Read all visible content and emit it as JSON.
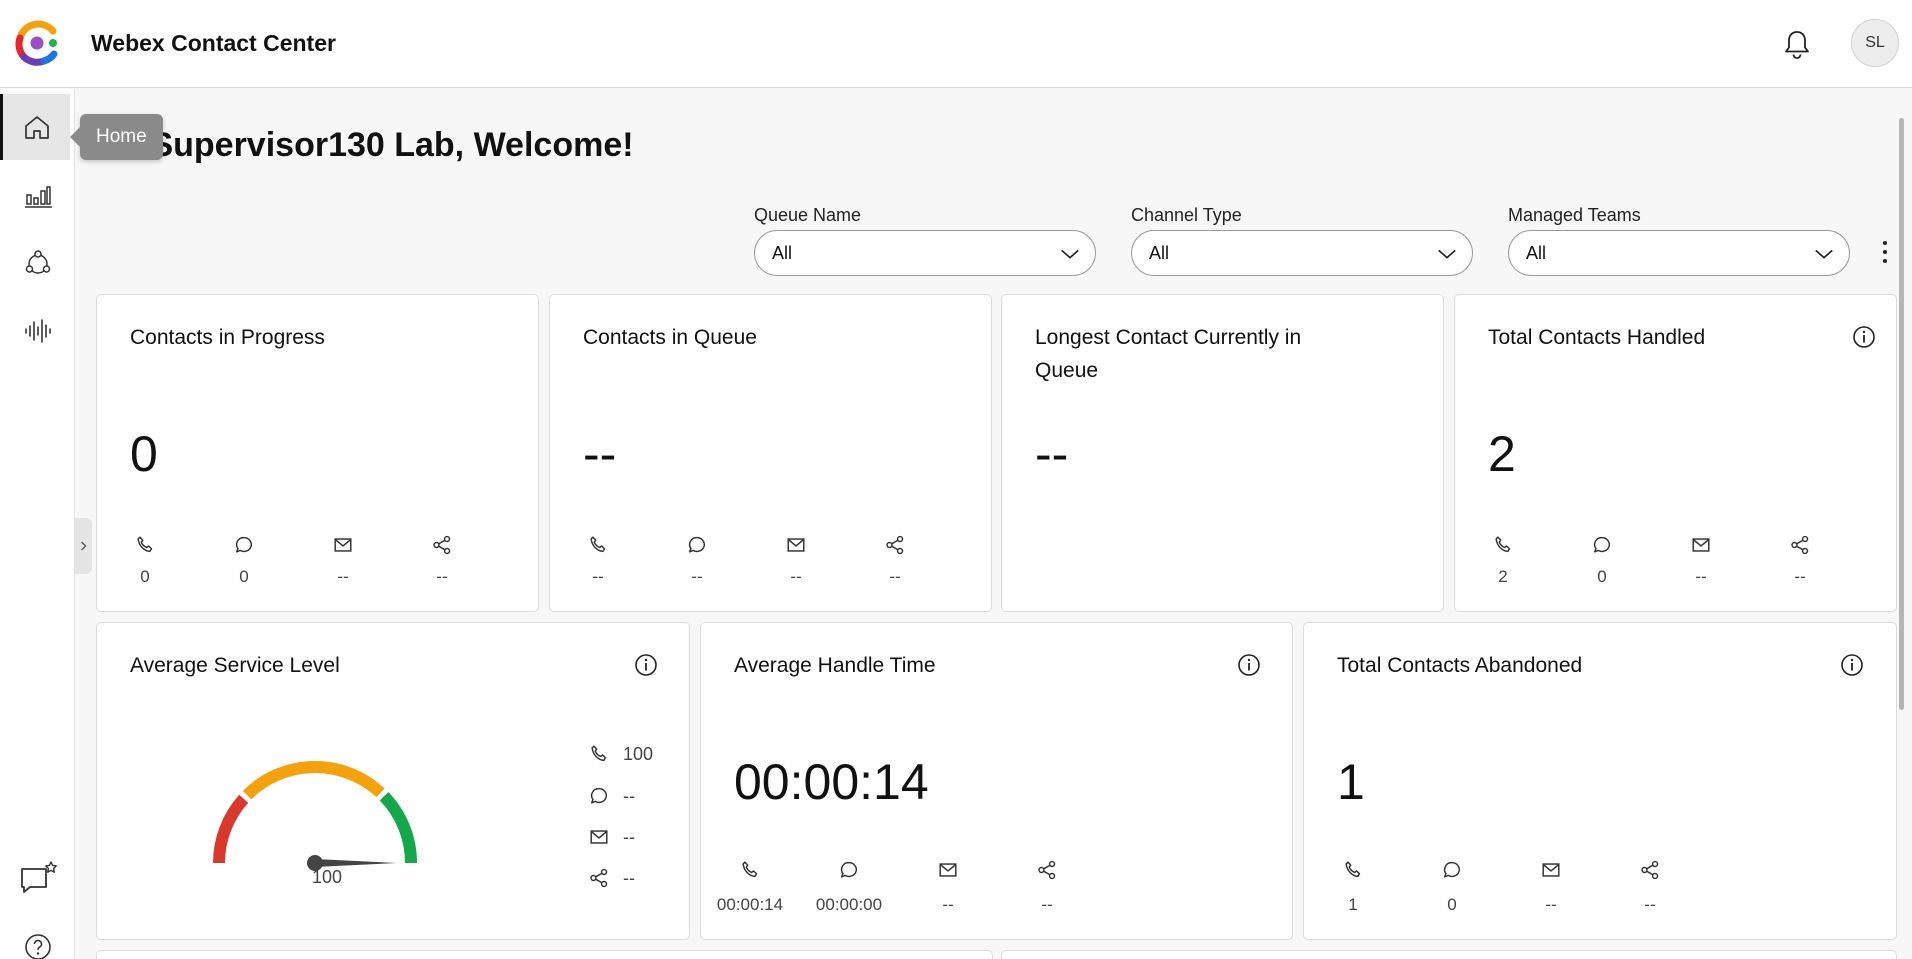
{
  "header": {
    "app_title": "Webex Contact Center",
    "avatar_initials": "SL"
  },
  "sidebar": {
    "tooltip": "Home",
    "items": [
      {
        "name": "home",
        "icon": "home-icon",
        "active": true
      },
      {
        "name": "analytics",
        "icon": "bar-chart-icon"
      },
      {
        "name": "connections",
        "icon": "network-icon"
      },
      {
        "name": "recordings",
        "icon": "audio-wave-icon"
      },
      {
        "name": "feedback",
        "icon": "chat-star-icon"
      },
      {
        "name": "help",
        "icon": "help-icon"
      }
    ]
  },
  "greeting": "Hi Supervisor130 Lab, Welcome!",
  "filters": [
    {
      "label": "Queue Name",
      "value": "All"
    },
    {
      "label": "Channel Type",
      "value": "All"
    },
    {
      "label": "Managed Teams",
      "value": "All"
    }
  ],
  "cards": {
    "contacts_in_progress": {
      "title": "Contacts in Progress",
      "value": "0",
      "channels": [
        "0",
        "0",
        "--",
        "--"
      ]
    },
    "contacts_in_queue": {
      "title": "Contacts in Queue",
      "value": "--",
      "channels": [
        "--",
        "--",
        "--",
        "--"
      ]
    },
    "longest_contact": {
      "title": "Longest Contact Currently in Queue",
      "value": "--"
    },
    "total_handled": {
      "title": "Total Contacts Handled",
      "value": "2",
      "channels": [
        "2",
        "0",
        "--",
        "--"
      ]
    },
    "avg_service_level": {
      "title": "Average Service Level",
      "gauge_value": "100",
      "gauge_fraction": 1.0,
      "channels": [
        "100",
        "--",
        "--",
        "--"
      ]
    },
    "avg_handle_time": {
      "title": "Average Handle Time",
      "value": "00:00:14",
      "channels": [
        "00:00:14",
        "00:00:00",
        "--",
        "--"
      ]
    },
    "total_abandoned": {
      "title": "Total Contacts Abandoned",
      "value": "1",
      "channels": [
        "1",
        "0",
        "--",
        "--"
      ]
    }
  },
  "colors": {
    "gauge_red": "#d9382b",
    "gauge_orange": "#f5a10b",
    "gauge_green": "#13a84a"
  }
}
